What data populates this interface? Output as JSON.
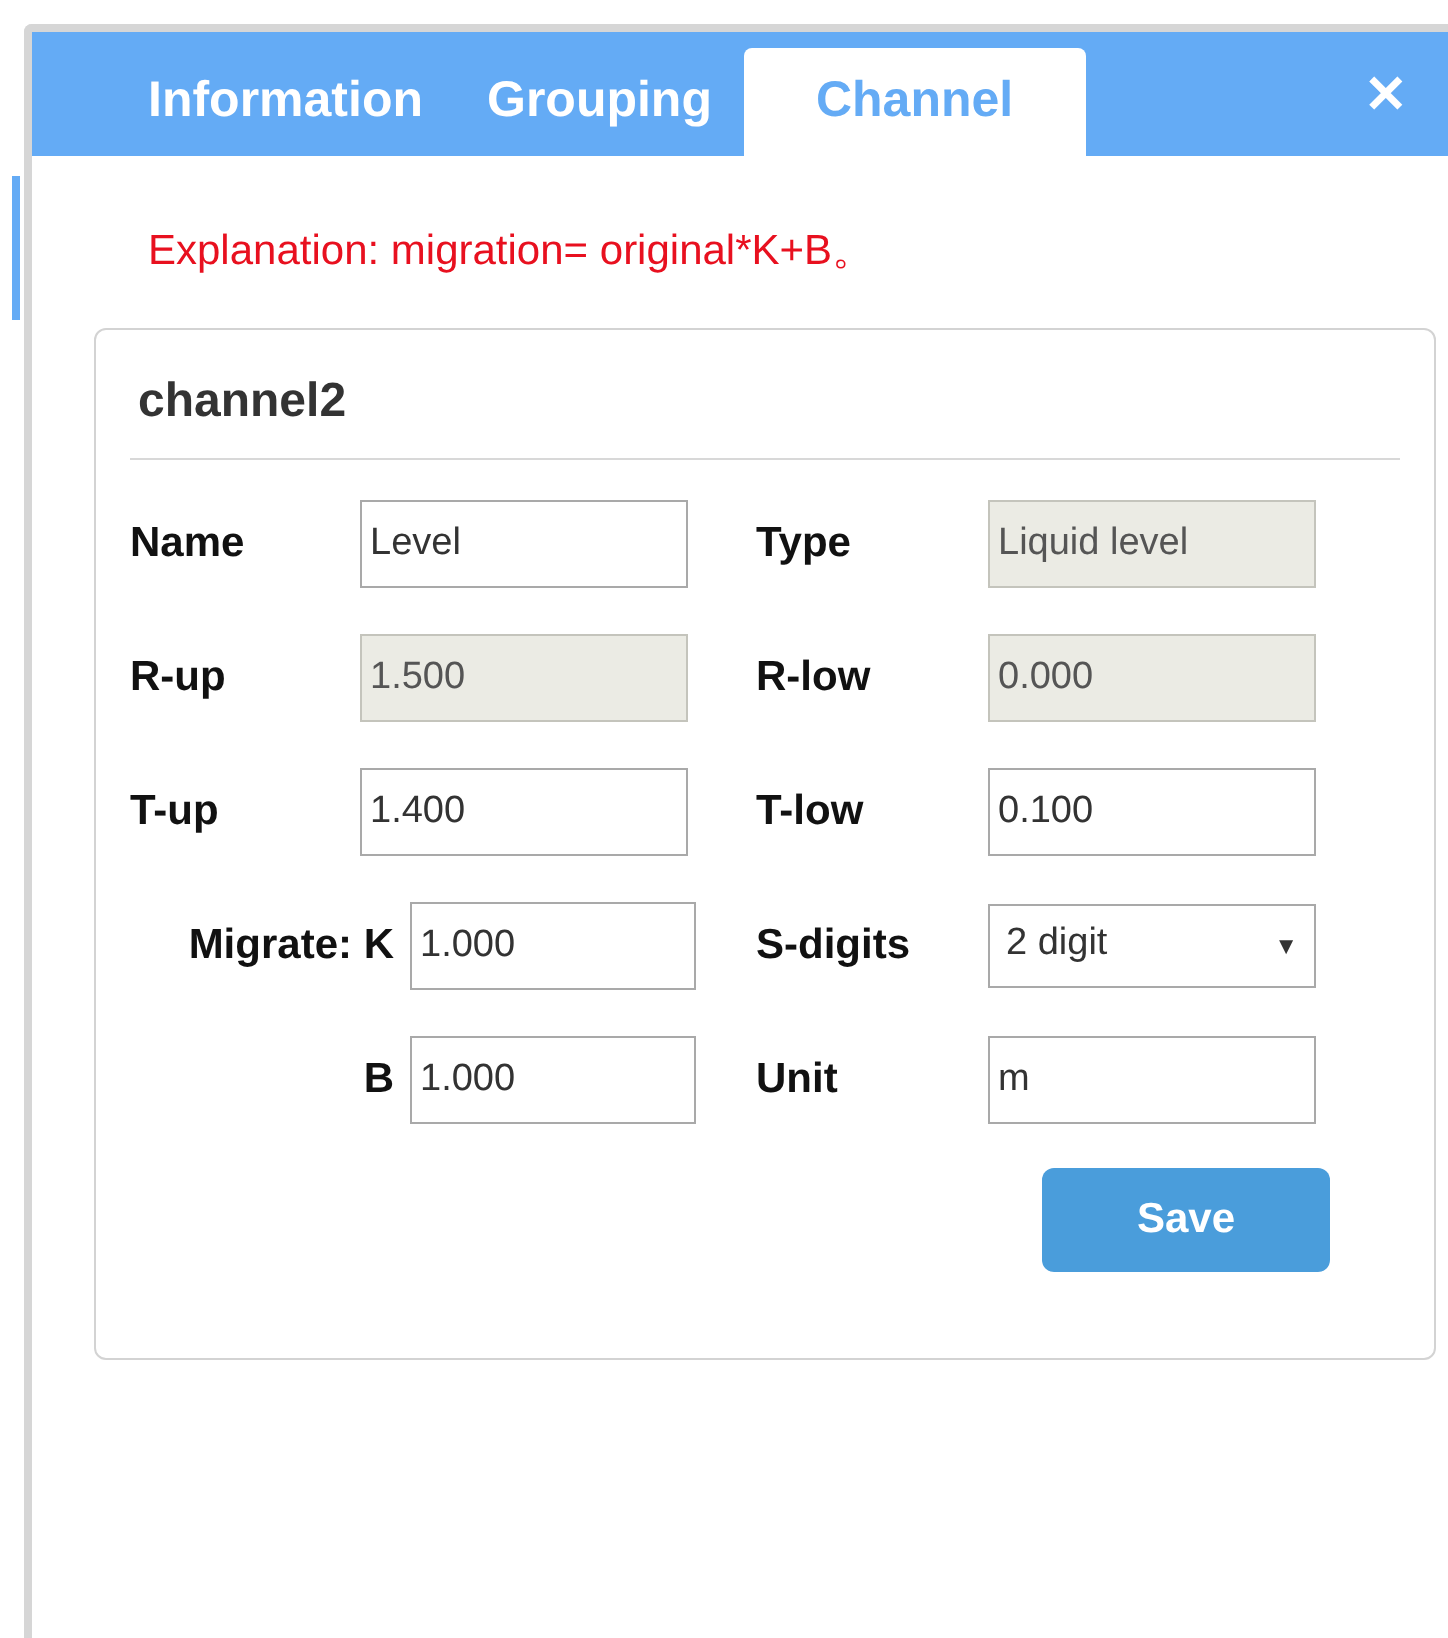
{
  "tabs": [
    {
      "label": "Information",
      "selected": false
    },
    {
      "label": "Grouping",
      "selected": false
    },
    {
      "label": "Channel",
      "selected": true
    }
  ],
  "close_button": "✕",
  "explanation": "Explanation: migration= original*K+B。",
  "card": {
    "title": "channel2",
    "rows": [
      {
        "left": {
          "label": "Name",
          "kind": "plain",
          "field": {
            "kind": "input",
            "value": "Level"
          }
        },
        "right": {
          "label": "Type",
          "field": {
            "kind": "readonly",
            "value": "Liquid level"
          }
        }
      },
      {
        "left": {
          "label": "R-up",
          "kind": "plain",
          "field": {
            "kind": "readonly",
            "value": "1.500"
          }
        },
        "right": {
          "label": "R-low",
          "field": {
            "kind": "readonly",
            "value": "0.000"
          }
        }
      },
      {
        "left": {
          "label": "T-up",
          "kind": "plain",
          "field": {
            "kind": "input",
            "value": "1.400"
          }
        },
        "right": {
          "label": "T-low",
          "field": {
            "kind": "input",
            "value": "0.100"
          }
        }
      },
      {
        "left": {
          "label": "Migrate: K",
          "kind": "coefficient",
          "field": {
            "kind": "input",
            "value": "1.000"
          }
        },
        "right": {
          "label": "S-digits",
          "field": {
            "kind": "select",
            "value": "2 digit",
            "arrow": "▼"
          }
        }
      },
      {
        "left": {
          "label": "B",
          "kind": "coefficient",
          "field": {
            "kind": "input",
            "value": "1.000"
          }
        },
        "right": {
          "label": "Unit",
          "field": {
            "kind": "input",
            "value": "m"
          }
        }
      }
    ],
    "save_button": "Save"
  }
}
